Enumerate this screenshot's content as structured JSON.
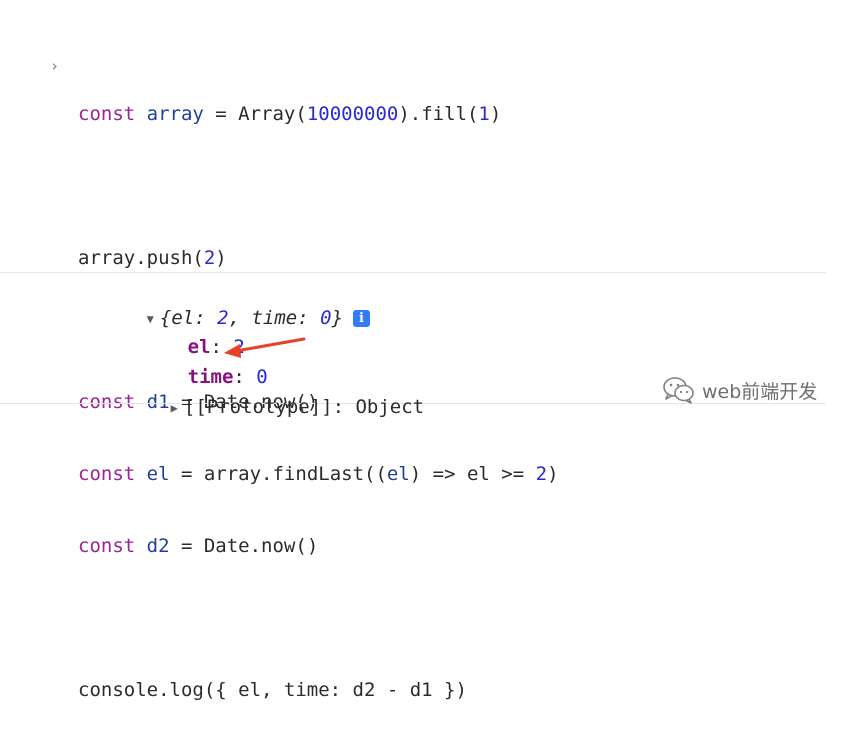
{
  "console": {
    "prompt_glyph": "›",
    "input": {
      "line1": {
        "kw": "const",
        "var": "array",
        "eq": " = Array(",
        "num1": "10000000",
        "mid": ").fill(",
        "num2": "1",
        "end": ")"
      },
      "line2": {
        "text": "array.push(",
        "num": "2",
        "end": ")"
      },
      "line3": {
        "kw": "const",
        "var": "d1",
        "rest": " = Date.now()"
      },
      "line4": {
        "kw": "const",
        "var": "el",
        "rest1": " = array.findLast((",
        "param": "el",
        "rest2": ") => el >= ",
        "num": "2",
        "end": ")"
      },
      "line5": {
        "kw": "const",
        "var": "d2",
        "rest": " = Date.now()"
      },
      "line6": {
        "text": "console.log({ el, time: d2 - d1 })"
      }
    },
    "output": {
      "preview": {
        "open": "{",
        "k1": "el",
        "sep1": ": ",
        "v1": "2",
        "comma": ", ",
        "k2": "time",
        "sep2": ": ",
        "v2": "0",
        "close": "}"
      },
      "info_badge": "i",
      "prop_el": {
        "key": "el",
        "sep": ": ",
        "value": "2"
      },
      "prop_time": {
        "key": "time",
        "sep": ": ",
        "value": "0"
      },
      "prototype": {
        "key": "[[Prototype]]",
        "sep": ": ",
        "value": "Object"
      }
    },
    "arrow_color": "#e8412a"
  },
  "watermark": {
    "icon": "wechat-logo-icon",
    "text": "web前端开发"
  }
}
